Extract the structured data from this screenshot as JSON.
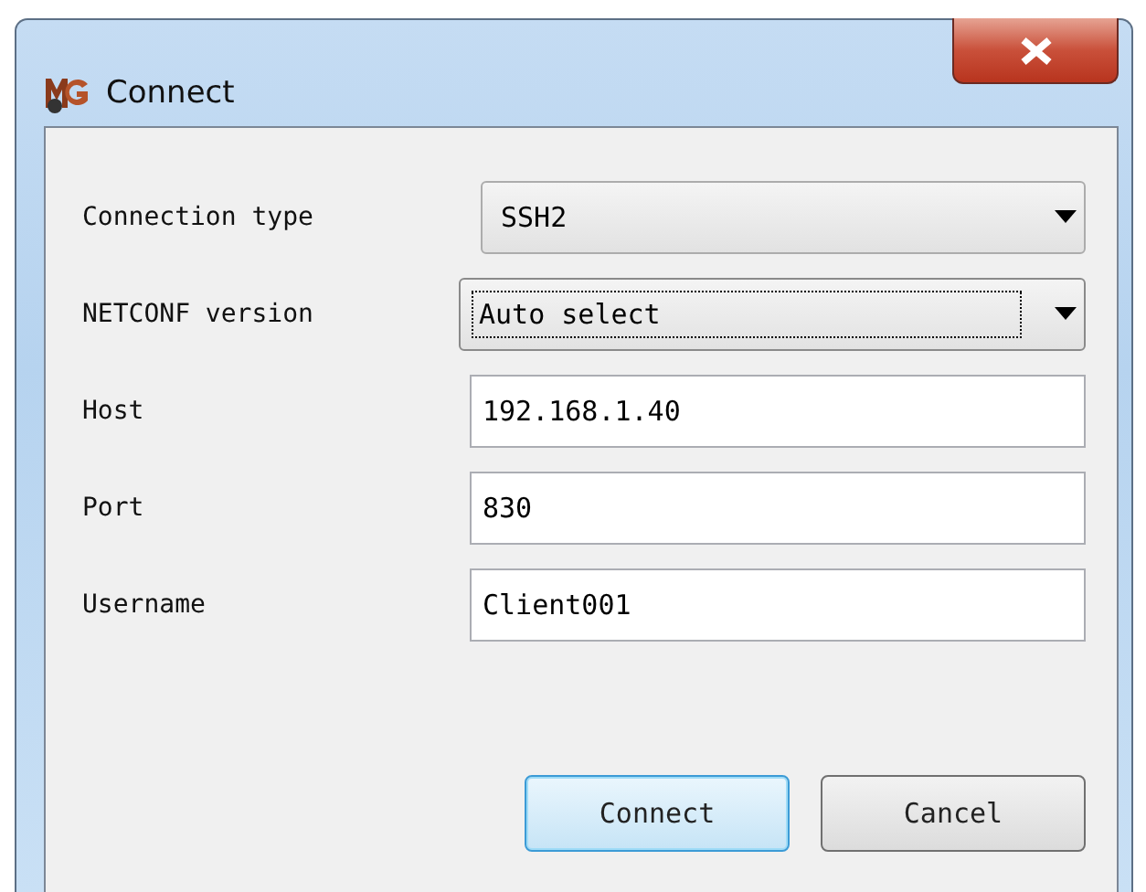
{
  "window": {
    "title": "Connect"
  },
  "fields": [
    {
      "label": "Connection type",
      "kind": "dropdown",
      "value": "SSH2",
      "focused": false
    },
    {
      "label": "NETCONF version",
      "kind": "dropdown",
      "value": "Auto select",
      "focused": true
    },
    {
      "label": "Host",
      "kind": "text",
      "value": "192.168.1.40"
    },
    {
      "label": "Port",
      "kind": "text",
      "value": "830"
    },
    {
      "label": "Username",
      "kind": "text",
      "value": "Client001"
    }
  ],
  "buttons": [
    {
      "label": "Connect",
      "default": true
    },
    {
      "label": "Cancel",
      "default": false
    }
  ]
}
